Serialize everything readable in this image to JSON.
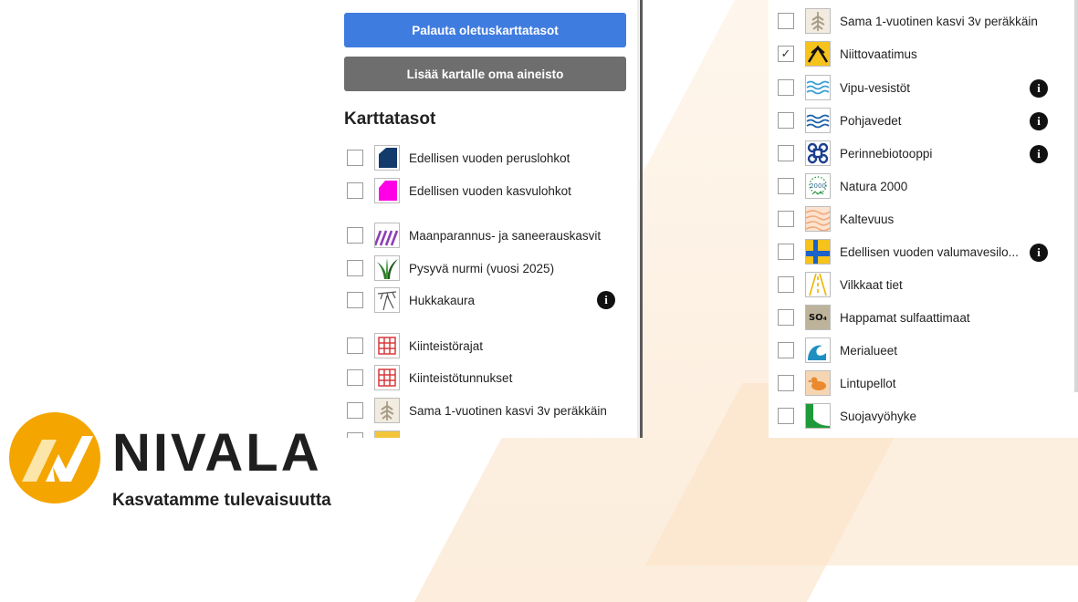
{
  "buttons": {
    "restore_defaults": "Palauta oletuskarttatasot",
    "add_own_data": "Lisää kartalle oma aineisto"
  },
  "section_title": "Karttatasot",
  "left_layers": [
    {
      "label": "Edellisen vuoden peruslohkot",
      "checked": false,
      "icon": "dark-blue-parcel-icon",
      "info": false
    },
    {
      "label": "Edellisen vuoden kasvulohkot",
      "checked": false,
      "icon": "magenta-parcel-icon",
      "info": false
    },
    {
      "label": "Maanparannus- ja saneerauskasvit",
      "checked": false,
      "icon": "purple-hatch-icon",
      "info": false
    },
    {
      "label": "Pysyvä nurmi (vuosi 2025)",
      "checked": false,
      "icon": "grass-icon",
      "info": false
    },
    {
      "label": "Hukkakaura",
      "checked": false,
      "icon": "wild-oat-icon",
      "info": true
    },
    {
      "label": "Kiinteistörajat",
      "checked": false,
      "icon": "red-grid-icon",
      "info": false
    },
    {
      "label": "Kiinteistötunnukset",
      "checked": false,
      "icon": "red-grid-icon",
      "info": false
    },
    {
      "label": "Sama 1-vuotinen kasvi 3v peräkkäin",
      "checked": false,
      "icon": "plant-icon",
      "info": false
    }
  ],
  "right_layers": [
    {
      "label": "Sama 1-vuotinen kasvi 3v peräkkäin",
      "checked": false,
      "icon": "plant-icon",
      "info": false
    },
    {
      "label": "Niittovaatimus",
      "checked": true,
      "icon": "mowing-icon",
      "info": false
    },
    {
      "label": "Vipu-vesistöt",
      "checked": false,
      "icon": "water-waves-icon",
      "info": true
    },
    {
      "label": "Pohjavedet",
      "checked": false,
      "icon": "groundwater-icon",
      "info": true
    },
    {
      "label": "Perinnebiotooppi",
      "checked": false,
      "icon": "biotope-icon",
      "info": true
    },
    {
      "label": "Natura 2000",
      "checked": false,
      "icon": "natura-icon",
      "info": false
    },
    {
      "label": "Kaltevuus",
      "checked": false,
      "icon": "slope-icon",
      "info": false
    },
    {
      "label": "Edellisen vuoden valumavesilo...",
      "checked": false,
      "icon": "runoff-icon",
      "info": true
    },
    {
      "label": "Vilkkaat tiet",
      "checked": false,
      "icon": "road-icon",
      "info": false
    },
    {
      "label": "Happamat sulfaattimaat",
      "checked": false,
      "icon": "sulfate-icon",
      "info": false
    },
    {
      "label": "Merialueet",
      "checked": false,
      "icon": "sea-wave-icon",
      "info": false
    },
    {
      "label": "Lintupellot",
      "checked": false,
      "icon": "bird-icon",
      "info": false
    },
    {
      "label": "Suojavyöhyke",
      "checked": false,
      "icon": "buffer-zone-icon",
      "info": false
    }
  ],
  "info_symbol": "i",
  "check_symbol": "✓",
  "sulfate_icon_text": "SO₄",
  "natura_icon_text": "2000",
  "logo": {
    "name": "NIVALA",
    "tagline": "Kasvatamme tulevaisuutta"
  },
  "colors": {
    "primary_button": "#3f7ce0",
    "secondary_button": "#6e6e6e",
    "logo_orange": "#f4a500"
  }
}
